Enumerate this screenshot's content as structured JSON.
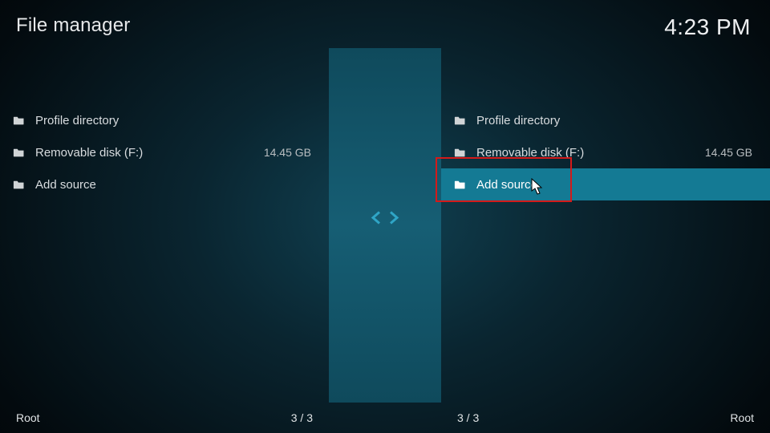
{
  "header": {
    "title": "File manager",
    "clock": "4:23 PM"
  },
  "panes": {
    "left": {
      "items": [
        {
          "label": "Profile directory",
          "size": ""
        },
        {
          "label": "Removable disk (F:)",
          "size": "14.45 GB"
        },
        {
          "label": "Add source",
          "size": ""
        }
      ],
      "footer_path": "Root",
      "footer_count": "3 / 3"
    },
    "right": {
      "items": [
        {
          "label": "Profile directory",
          "size": ""
        },
        {
          "label": "Removable disk (F:)",
          "size": "14.45 GB"
        },
        {
          "label": "Add source",
          "size": ""
        }
      ],
      "footer_path": "Root",
      "footer_count": "3 / 3"
    }
  },
  "selected": {
    "pane": "right",
    "index": 2
  }
}
